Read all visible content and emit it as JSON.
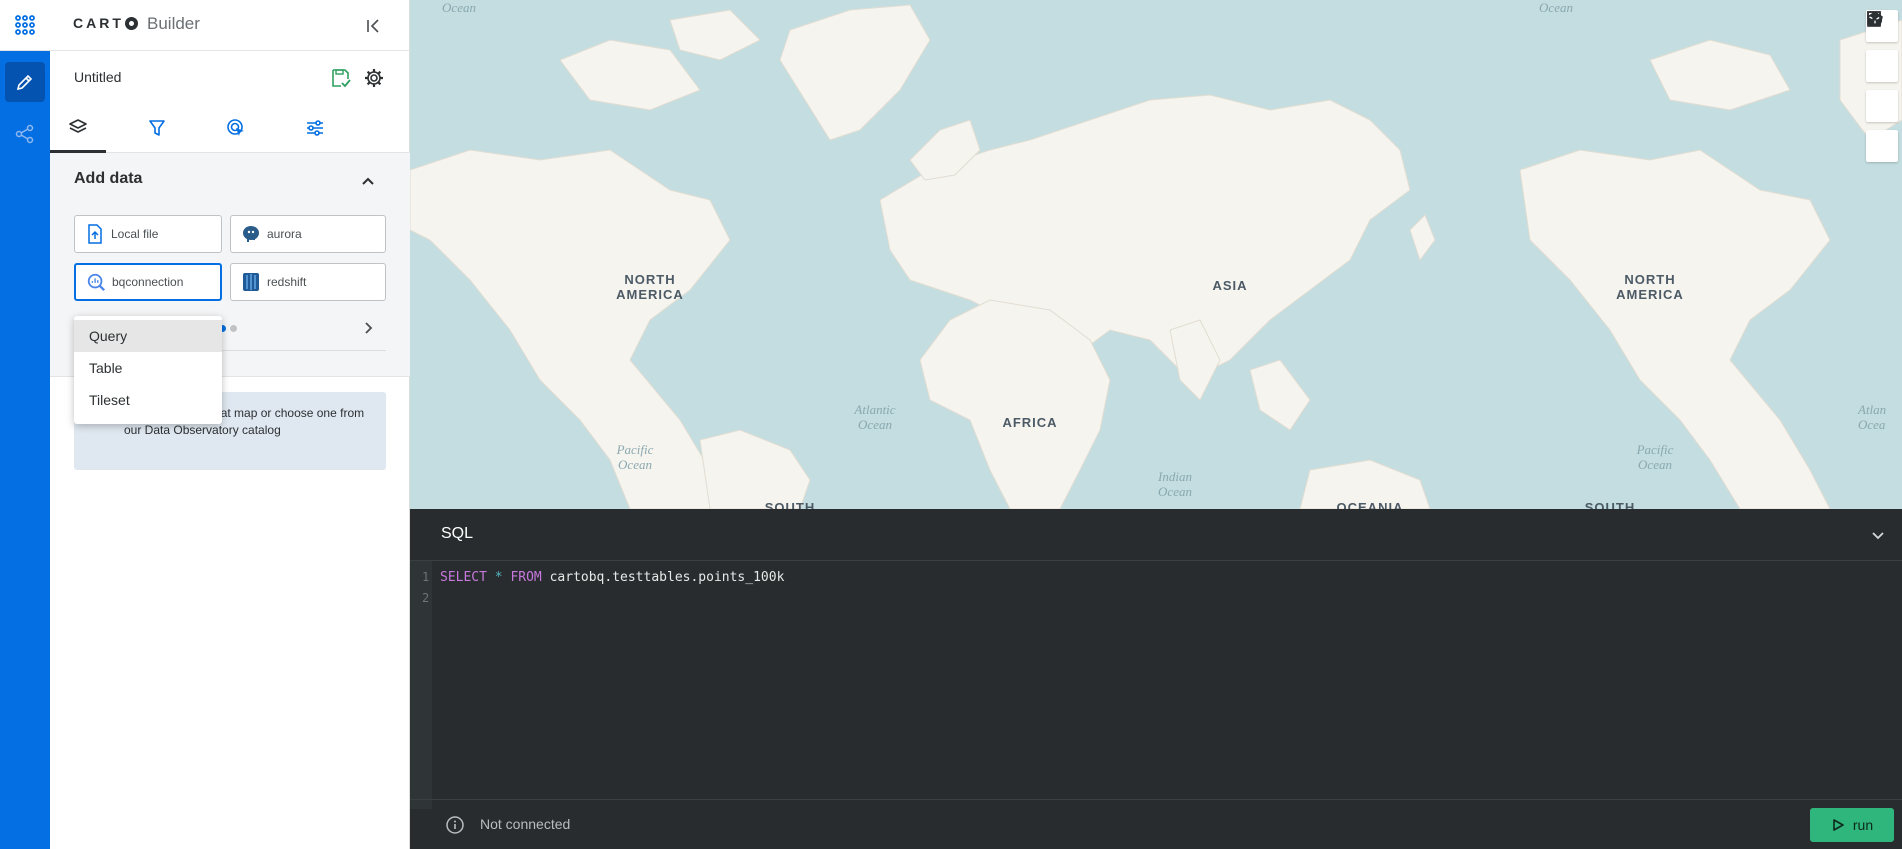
{
  "brand": {
    "logo": "CARTO",
    "product": "Builder"
  },
  "map_title": "Untitled",
  "tabs": [
    {
      "name": "layers",
      "icon": "layers-icon"
    },
    {
      "name": "filters",
      "icon": "filter-icon"
    },
    {
      "name": "interactions",
      "icon": "interaction-icon"
    },
    {
      "name": "settings",
      "icon": "sliders-icon"
    }
  ],
  "add_data": {
    "title": "Add data",
    "sources": [
      "Local file",
      "aurora",
      "bqconnection",
      "redshift"
    ],
    "info_text": "...art making a great map or choose one from our Data Observatory catalog"
  },
  "dropdown": {
    "items": [
      "Query",
      "Table",
      "Tileset"
    ]
  },
  "map": {
    "labels": [
      "NORTH AMERICA",
      "ASIA",
      "AFRICA",
      "SOUTH",
      "OCEANIA",
      "NORTH AMERICA",
      "SOUTH"
    ],
    "oceans": [
      "Ocean",
      "Ocean",
      "Atlantic Ocean",
      "Pacific Ocean",
      "Indian Ocean",
      "Pacific Ocean",
      "Atlan Ocea"
    ]
  },
  "sql": {
    "title": "SQL",
    "line1_kw1": "SELECT",
    "line1_op": "*",
    "line1_kw2": "FROM",
    "line1_table": "cartobq.testtables.points_100k",
    "line_numbers": [
      "1",
      "2"
    ],
    "status": "Not connected",
    "run_label": "run"
  },
  "colors": {
    "rail": "#036fe2",
    "run": "#2fb67c",
    "map_water": "#c3dde0",
    "map_land": "#f6f4ef"
  }
}
